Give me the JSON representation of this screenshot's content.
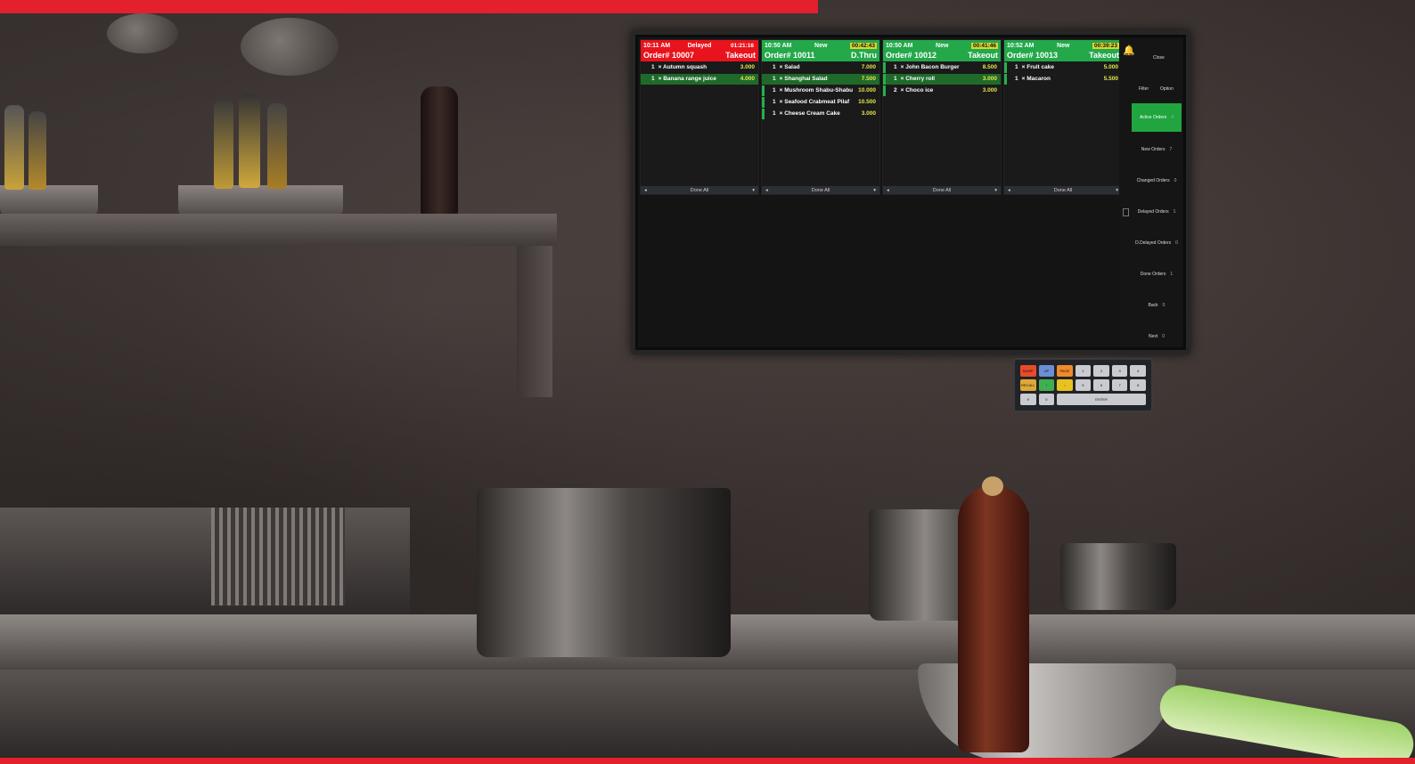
{
  "orders": [
    {
      "time": "10:11 AM",
      "status": "Delayed",
      "timer": "01:21:16",
      "number": "Order# 10007",
      "type": "Takeout",
      "items": [
        {
          "qty": "1",
          "name": "Autumn squash",
          "price": "3.000"
        },
        {
          "qty": "1",
          "name": "Banana range juice",
          "price": "4.000"
        }
      ],
      "footer": "Done All"
    },
    {
      "time": "10:50 AM",
      "status": "New",
      "timer": "00:42:43",
      "number": "Order# 10011",
      "type": "D.Thru",
      "items": [
        {
          "qty": "1",
          "name": "Salad",
          "price": "7.000"
        },
        {
          "qty": "1",
          "name": "Shanghai Salad",
          "price": "7.500"
        },
        {
          "qty": "1",
          "name": "Mushroom Shabu-Shabu",
          "price": "10.000"
        },
        {
          "qty": "1",
          "name": "Seafood Crabmeat Pilaf",
          "price": "10.500"
        },
        {
          "qty": "1",
          "name": "Cheese Cream Cake",
          "price": "3.000"
        }
      ],
      "footer": "Done All"
    },
    {
      "time": "10:50 AM",
      "status": "New",
      "timer": "00:41:46",
      "number": "Order# 10012",
      "type": "Takeout",
      "items": [
        {
          "qty": "1",
          "name": "John Bacon Burger",
          "price": "8.500"
        },
        {
          "qty": "1",
          "name": "Cherry roll",
          "price": "3.000"
        },
        {
          "qty": "2",
          "name": "Choco ice",
          "price": "3.000"
        }
      ],
      "footer": "Done All"
    },
    {
      "time": "10:52 AM",
      "status": "New",
      "timer": "00:39:23",
      "number": "Order# 10013",
      "type": "Takeout",
      "items": [
        {
          "qty": "1",
          "name": "Fruit cake",
          "price": "5.000"
        },
        {
          "qty": "1",
          "name": "Macaron",
          "price": "5.500"
        }
      ],
      "footer": "Done All"
    }
  ],
  "sidebar": {
    "close": "Close",
    "filter": "Filter",
    "option": "Option",
    "buttons": [
      {
        "label": "Active Orders",
        "count": "4"
      },
      {
        "label": "New Orders",
        "count": "7"
      },
      {
        "label": "Changed Orders",
        "count": "0"
      },
      {
        "label": "Delayed Orders",
        "count": "1"
      },
      {
        "label": "D.Delayed Orders",
        "count": "0"
      },
      {
        "label": "Done Orders",
        "count": "1"
      },
      {
        "label": "Back",
        "count": "0"
      },
      {
        "label": "Next",
        "count": "0"
      }
    ]
  },
  "colors": {
    "delayed": "#e8131c",
    "new": "#23a84a",
    "brand_red": "#e3202b",
    "active_button": "#20a53f"
  },
  "keypad": {
    "keys": [
      "BUMP",
      "UP",
      "PAGE",
      "1",
      "2",
      "3",
      "4",
      "RECALL",
      "↑",
      "↓",
      "5",
      "6",
      "7",
      "8",
      "9",
      "0",
      "ENTER"
    ]
  }
}
